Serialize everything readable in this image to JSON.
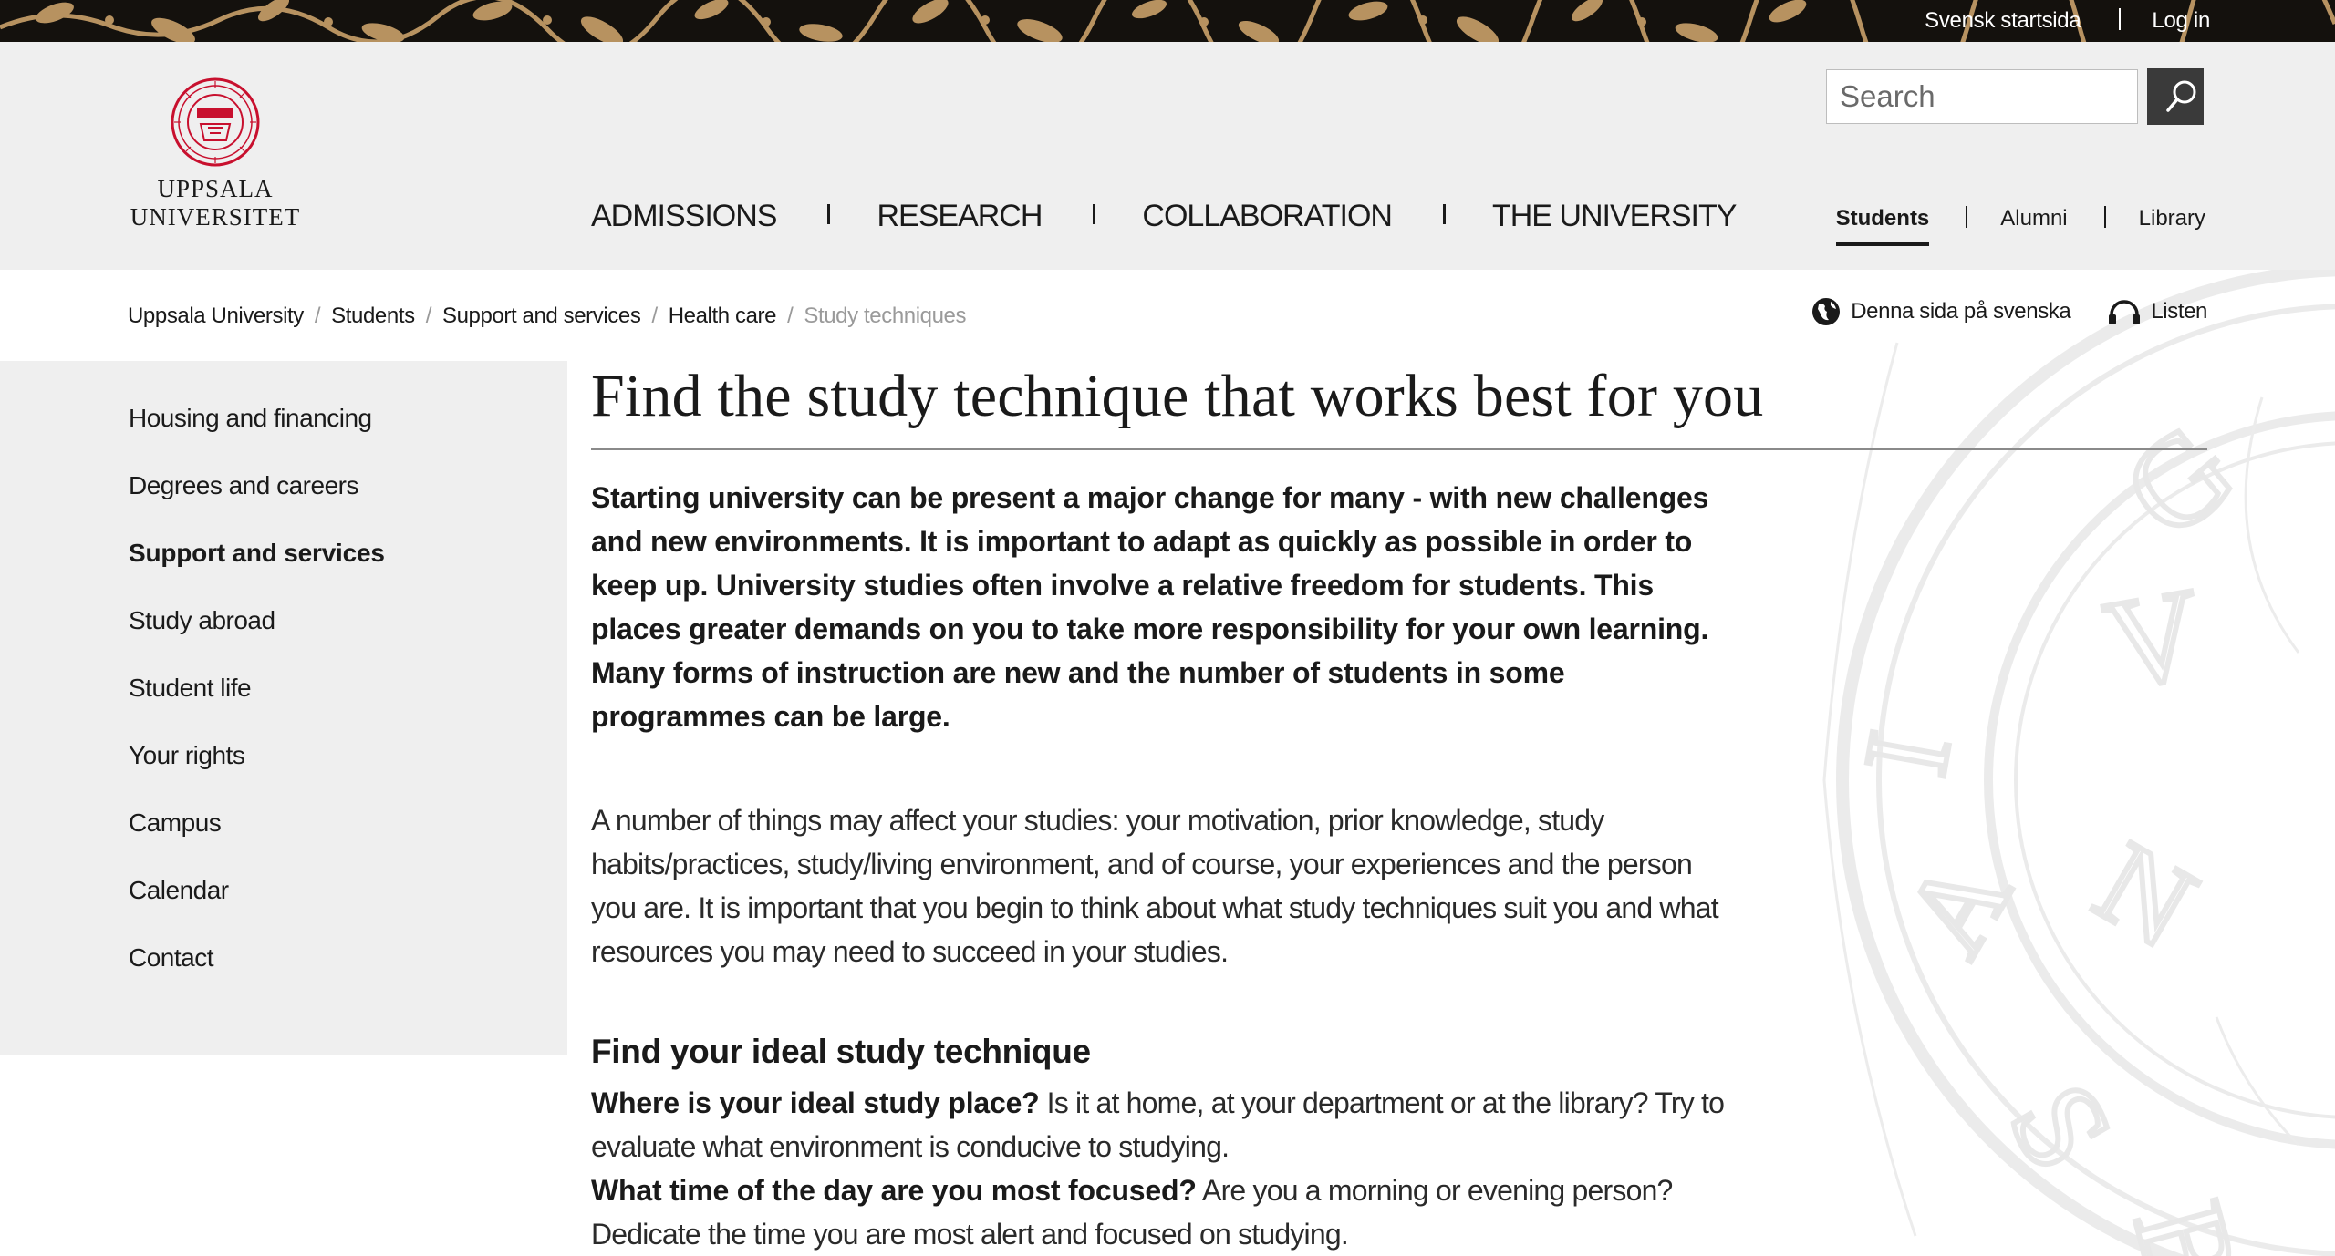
{
  "topbar": {
    "links": [
      "Svensk startsida",
      "Log in"
    ],
    "ornament_colors": {
      "background": "#14110d",
      "leaf": "#c9a16a"
    }
  },
  "logo": {
    "line1": "UPPSALA",
    "line2": "UNIVERSITET",
    "color": "#c8102e"
  },
  "search": {
    "placeholder": "Search"
  },
  "main_nav": [
    "ADMISSIONS",
    "RESEARCH",
    "COLLABORATION",
    "THE UNIVERSITY"
  ],
  "audience_nav": {
    "items": [
      "Students",
      "Alumni",
      "Library"
    ],
    "active": "Students"
  },
  "breadcrumb": [
    "Uppsala University",
    "Students",
    "Support and services",
    "Health care",
    "Study techniques"
  ],
  "tools": {
    "language": "Denna sida på svenska",
    "listen": "Listen"
  },
  "sidebar": {
    "items": [
      "Housing and financing",
      "Degrees and careers",
      "Support and services",
      "Study abroad",
      "Student life",
      "Your rights",
      "Campus",
      "Calendar",
      "Contact"
    ],
    "active": "Support and services"
  },
  "content": {
    "title": "Find the study technique that works best for you",
    "lead": "Starting university can be present a major change for many - with new challenges and new environments. It is important to adapt as quickly as possible in order to keep up. University studies often involve a relative freedom for students. This places greater demands on you to take more responsibility for your own learning. Many forms of instruction are new and the number of students in some programmes can be large.",
    "paragraph": "A number of things may affect your studies: your motivation, prior knowledge, study habits/practices, study/living environment, and of course, your experiences and the person you are. It is important that you begin to think about what study techniques suit you and what resources you may need to succeed in your studies.",
    "section_heading": "Find your ideal study technique",
    "questions": [
      {
        "q": "Where is your ideal study place?",
        "a": " Is it at home, at your department or at the library? Try to evaluate what environment is conducive to studying."
      },
      {
        "q": "What time of the day are you most focused?",
        "a": " Are you a morning or evening person? Dedicate the time you are most alert and focused on studying."
      }
    ]
  }
}
